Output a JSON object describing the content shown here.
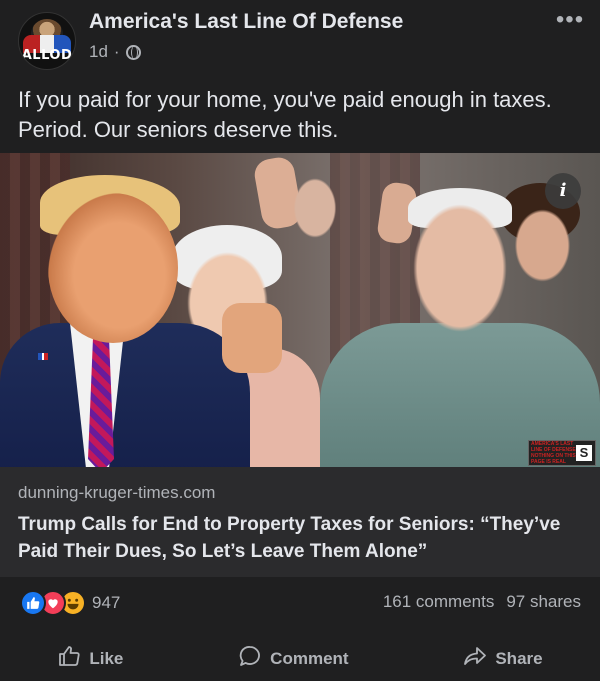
{
  "post": {
    "page_name": "America's Last Line Of Defense",
    "avatar_text": "ALLOD",
    "time": "1d",
    "separator": "·",
    "more_label": "•••",
    "caption": "If you paid for your home, you've paid enough in taxes. Period. Our seniors deserve this."
  },
  "link": {
    "info_label": "i",
    "badge_text": "AMERICA'S LAST LINE OF DEFENSE NOTHING ON THIS PAGE IS REAL",
    "badge_satire": "SATIRE",
    "badge_letter": "S",
    "domain": "dunning-kruger-times.com",
    "headline": "Trump Calls for End to Property Taxes for Seniors: “They’ve Paid Their Dues, So Let’s Leave Them Alone”"
  },
  "engagement": {
    "reaction_count": "947",
    "comments": "161 comments",
    "shares": "97 shares",
    "reactions": [
      "like",
      "love",
      "haha"
    ]
  },
  "actions": {
    "like": "Like",
    "comment": "Comment",
    "share": "Share"
  },
  "colors": {
    "background": "#1f1f20",
    "link_meta_bg": "#2b2b2d",
    "like_blue": "#1877f2",
    "love_red": "#f33e58",
    "haha_yellow": "#f7b125"
  }
}
